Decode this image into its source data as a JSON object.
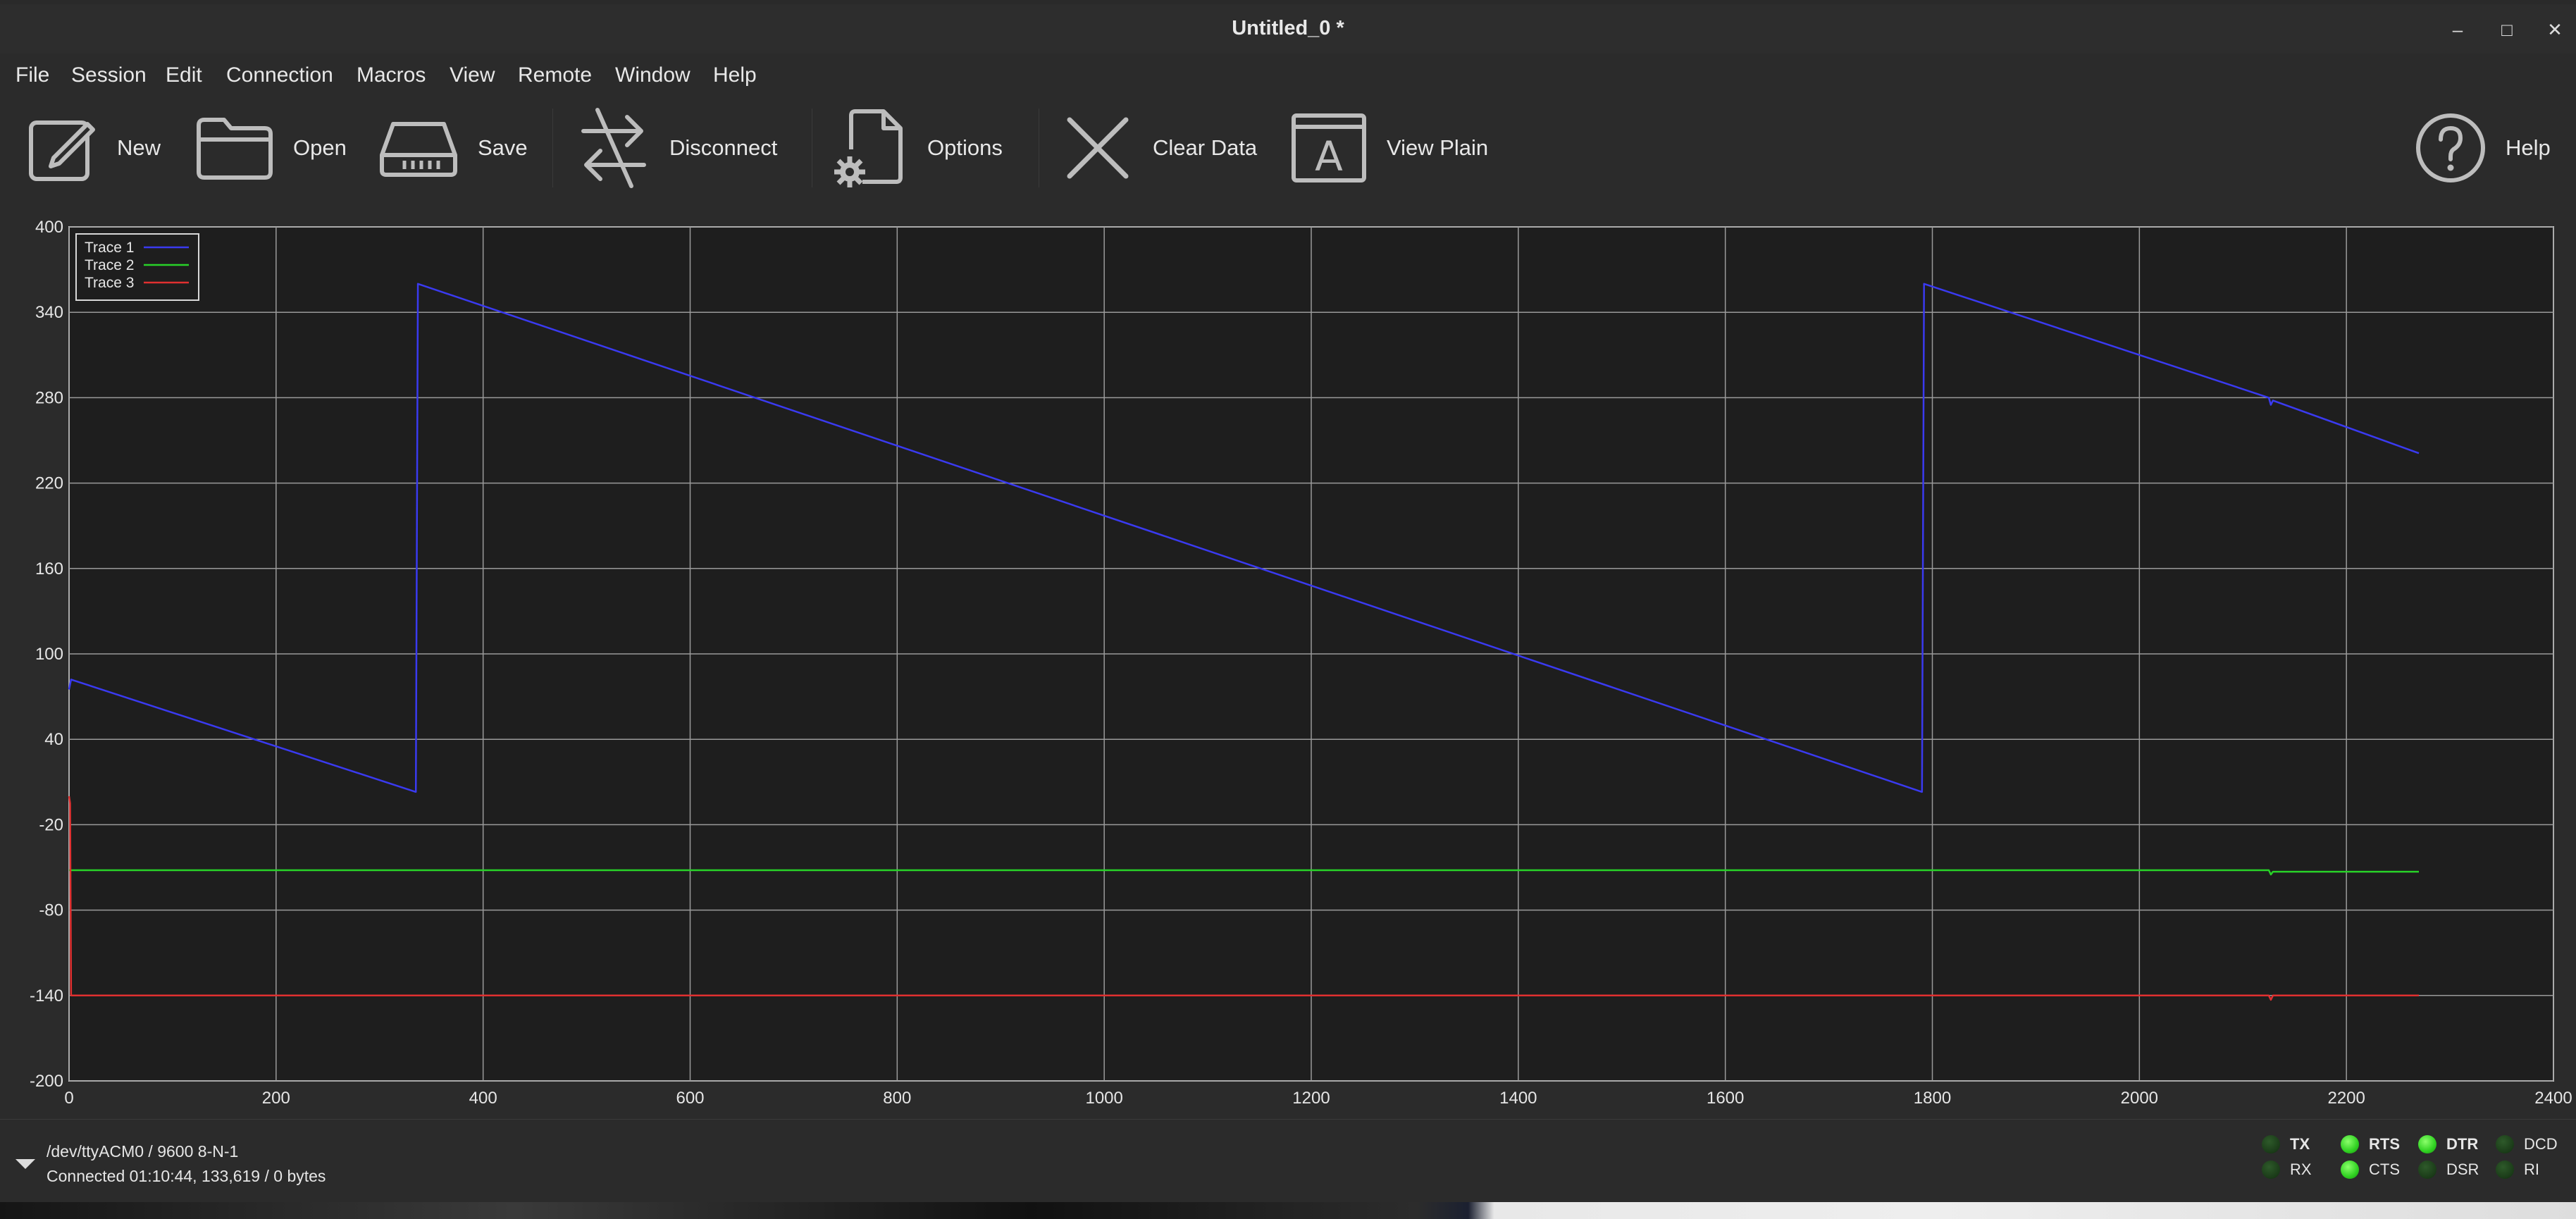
{
  "window": {
    "title": "Untitled_0 *"
  },
  "window_controls": [
    "minimize-icon",
    "maximize-icon",
    "close-icon"
  ],
  "menu": [
    "File",
    "Session",
    "Edit",
    "Connection",
    "Macros",
    "View",
    "Remote",
    "Window",
    "Help"
  ],
  "toolbar": {
    "new": "New",
    "open": "Open",
    "save": "Save",
    "disconnect": "Disconnect",
    "options": "Options",
    "clear": "Clear Data",
    "view_plain": "View Plain",
    "help": "Help"
  },
  "chart_data": {
    "type": "line",
    "xlim": [
      0,
      2400
    ],
    "ylim": [
      -200,
      400
    ],
    "xticks": [
      0,
      200,
      400,
      600,
      800,
      1000,
      1200,
      1400,
      1600,
      1800,
      2000,
      2200,
      2400
    ],
    "yticks": [
      -200,
      -140,
      -80,
      -20,
      40,
      100,
      160,
      220,
      280,
      340,
      400
    ],
    "grid": true,
    "background": "#1e1e1e",
    "legend_position": "top-left",
    "series": [
      {
        "name": "Trace 1",
        "color": "#3a3af0",
        "x": [
          0,
          2,
          335,
          337,
          1790,
          1792,
          2125,
          2127,
          2129,
          2270
        ],
        "y": [
          75,
          82,
          3,
          360,
          3,
          360,
          280,
          275,
          278,
          241
        ]
      },
      {
        "name": "Trace 2",
        "color": "#28d228",
        "x": [
          0,
          2125,
          2127,
          2129,
          2270
        ],
        "y": [
          -52,
          -52,
          -55,
          -53,
          -53
        ]
      },
      {
        "name": "Trace 3",
        "color": "#e03030",
        "x": [
          0,
          1,
          2,
          2125,
          2127,
          2129,
          2270
        ],
        "y": [
          0,
          -5,
          -140,
          -140,
          -143,
          -140,
          -140
        ]
      }
    ]
  },
  "status": {
    "port": "/dev/ttyACM0 / 9600 8-N-1",
    "connection": "Connected 01:10:44, 133,619 / 0 bytes",
    "leds": [
      {
        "label": "TX",
        "on": false,
        "bold": true
      },
      {
        "label": "RX",
        "on": false,
        "bold": false
      },
      {
        "label": "RTS",
        "on": true,
        "bold": true
      },
      {
        "label": "CTS",
        "on": true,
        "bold": false
      },
      {
        "label": "DTR",
        "on": true,
        "bold": true
      },
      {
        "label": "DSR",
        "on": false,
        "bold": false
      },
      {
        "label": "DCD",
        "on": false,
        "bold": false
      },
      {
        "label": "RI",
        "on": false,
        "bold": false
      }
    ]
  }
}
